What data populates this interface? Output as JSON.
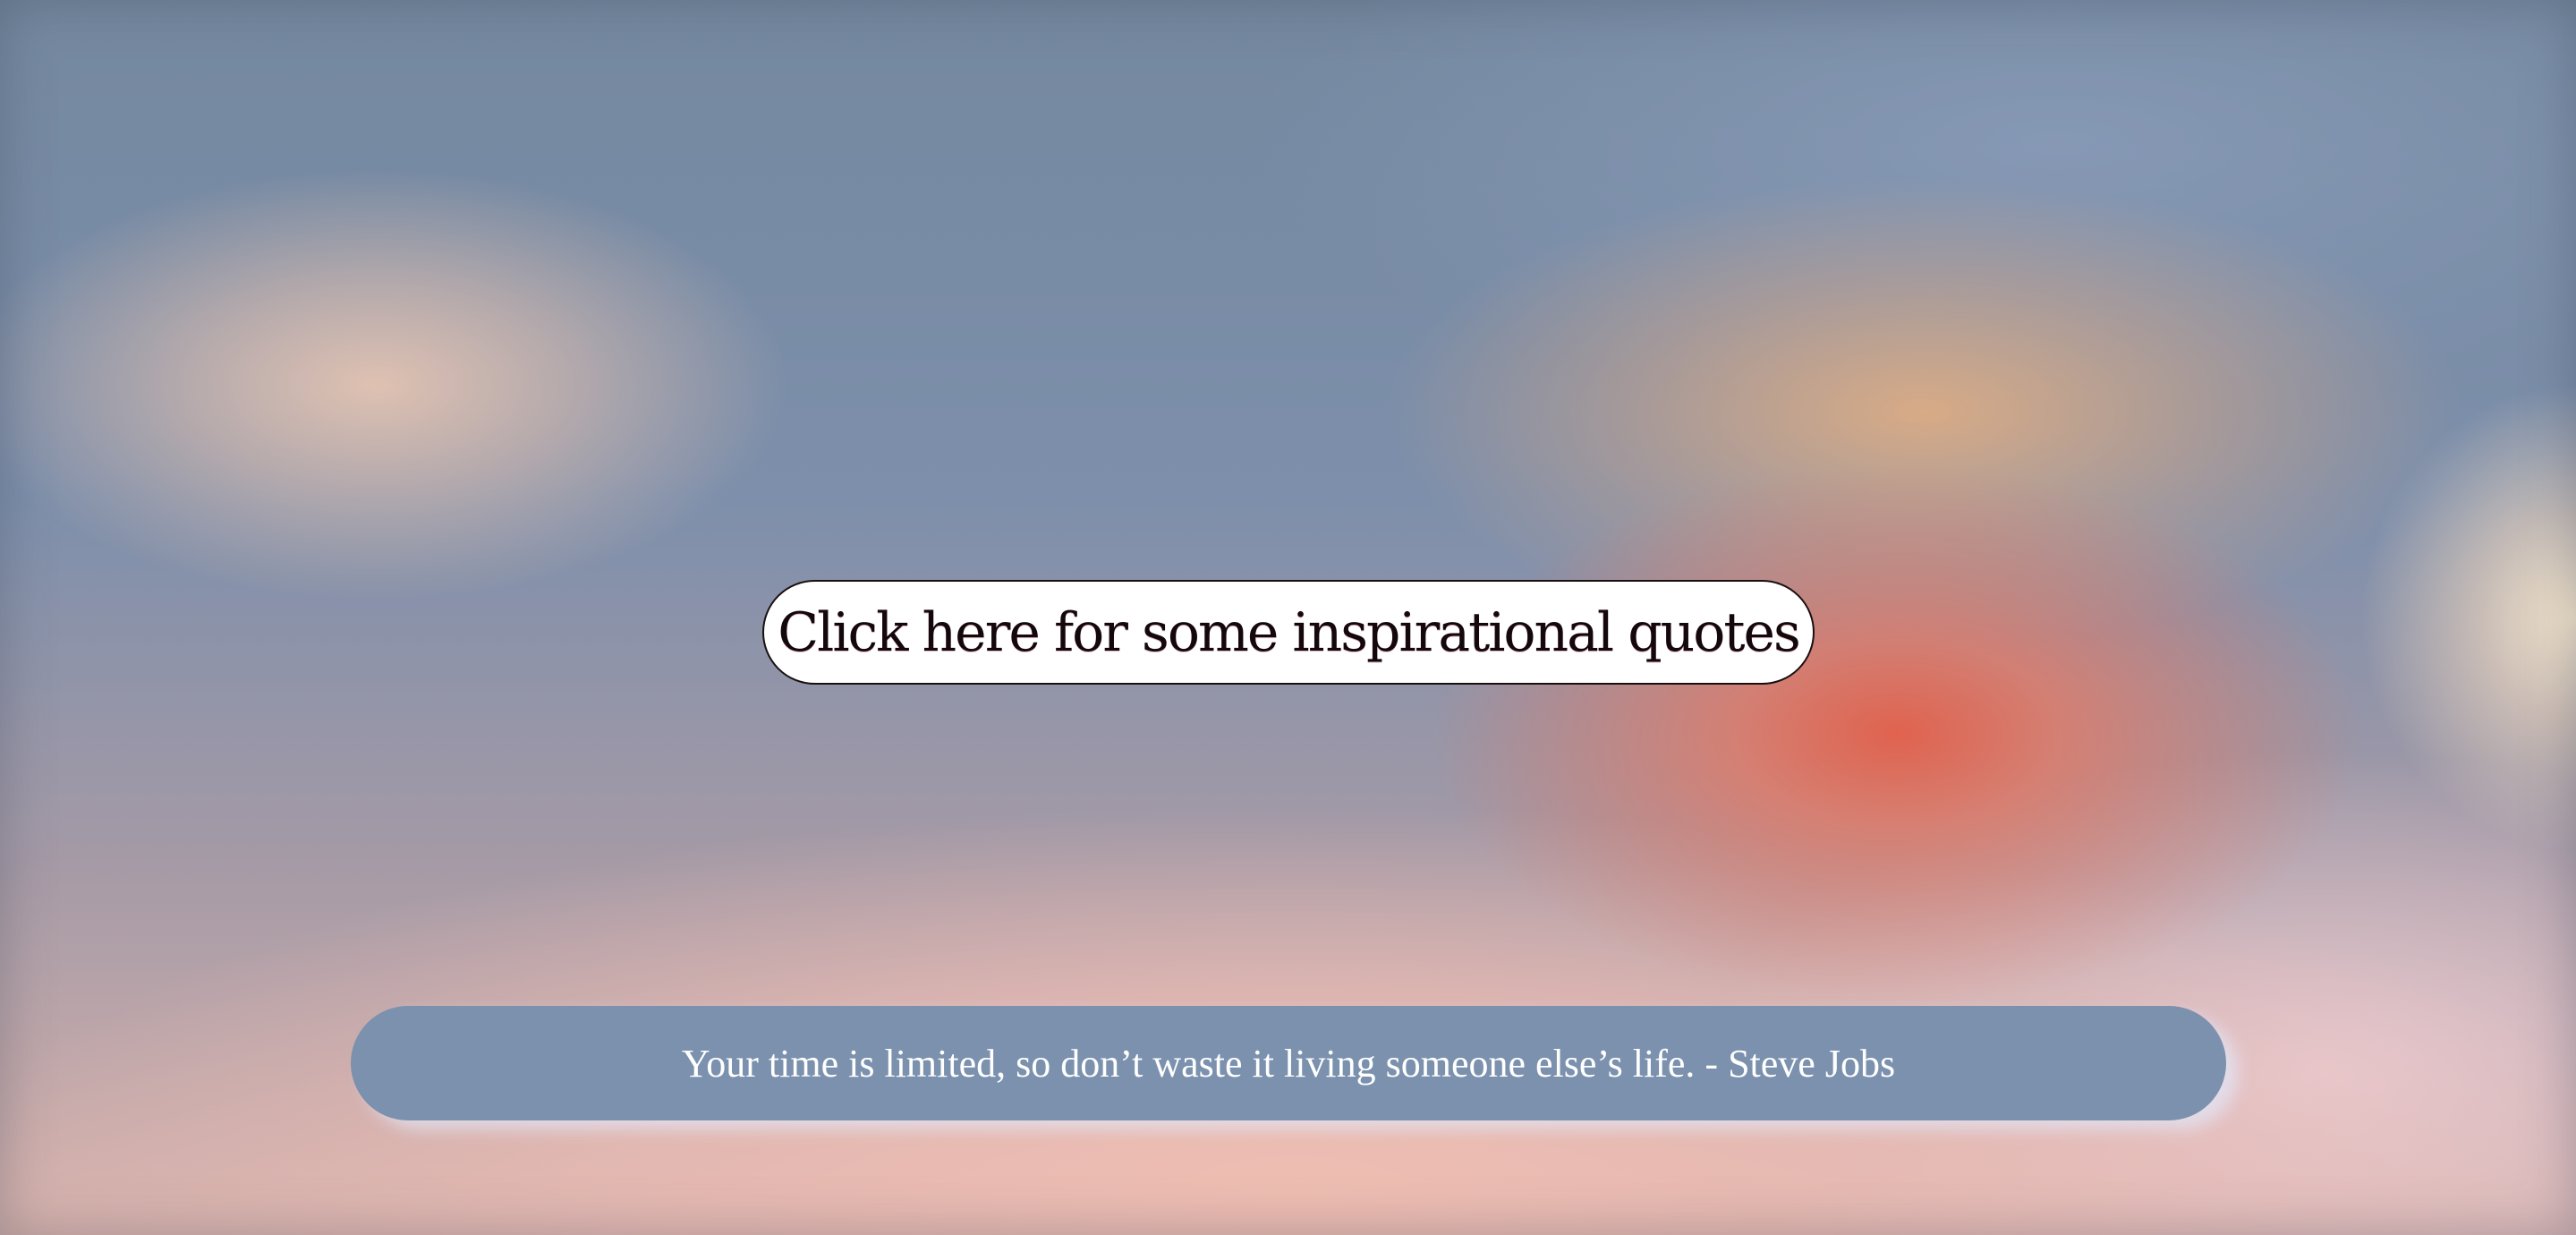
{
  "page": {
    "background_colors": [
      "#7d8fab",
      "#e4604a",
      "#e8b080",
      "#e4c4b2",
      "#f0beb2",
      "#f5e6cd"
    ]
  },
  "quote_button": {
    "label": "Click here for some inspirational quotes",
    "background": "#ffffff",
    "text_color": "#14080c"
  },
  "quote_display": {
    "text": "Your time is limited, so don’t waste it living someone else’s life. - Steve Jobs",
    "background": "#7b91ae",
    "text_color": "#ffffff"
  }
}
